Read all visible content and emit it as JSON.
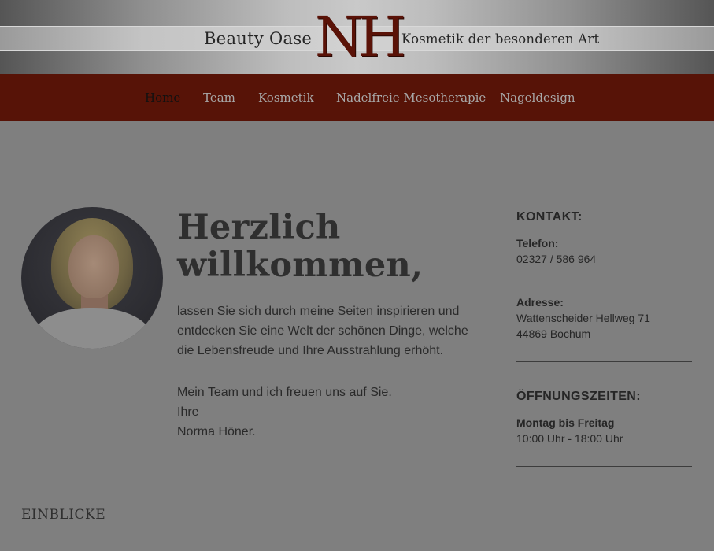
{
  "header": {
    "brand_left": "Beauty Oase",
    "logo_letters": "NH",
    "brand_right": "Kosmetik der besonderen Art"
  },
  "nav": {
    "items": [
      {
        "label": "Home",
        "active": true
      },
      {
        "label": "Team",
        "active": false
      },
      {
        "label": "Kosmetik",
        "active": false
      },
      {
        "label": "Nadelfreie Mesotherapie",
        "active": false
      },
      {
        "label": "Nageldesign",
        "active": false
      }
    ]
  },
  "welcome": {
    "title_line1": "Herzlich",
    "title_line2": "willkommen,",
    "paragraph_line1": "lassen Sie sich durch meine Seiten inspirieren und",
    "paragraph_line2": "entdecken Sie eine Welt der schönen Dinge, welche",
    "paragraph_line3": "die Lebensfreude und Ihre Ausstrahlung erhöht.",
    "team_line": "Mein Team und ich freuen uns auf Sie.",
    "ihre": "Ihre",
    "signature": "Norma Höner."
  },
  "contact": {
    "heading": "KONTAKT:",
    "phone_label": "Telefon:",
    "phone_value": "02327 / 586 964",
    "address_label": "Adresse:",
    "address_line1": "Wattenscheider Hellweg 71",
    "address_line2": "44869 Bochum"
  },
  "hours": {
    "heading": "ÖFFNUNGSZEITEN:",
    "days_label": "Montag bis Freitag",
    "time_value": "10:00 Uhr - 18:00 Uhr"
  },
  "section": {
    "einblicke": "EINBLICKE"
  },
  "colors": {
    "nav_background": "#571307",
    "logo_red": "#5a1207",
    "page_overlay": "#7f7f7f"
  }
}
